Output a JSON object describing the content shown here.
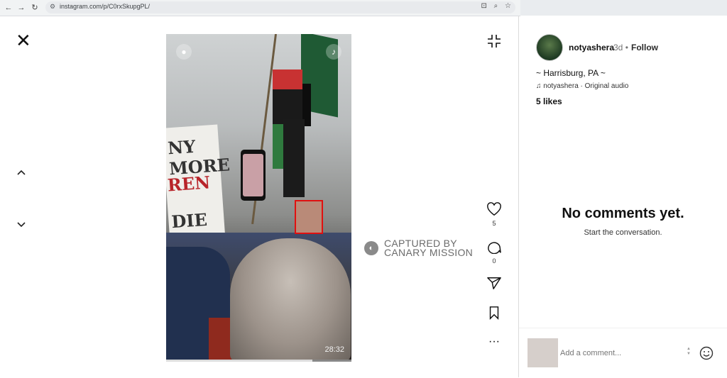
{
  "browser": {
    "url": "instagram.com/p/C0rxSkupgPL/",
    "nav": {
      "back": "←",
      "forward": "→",
      "reload": "↻"
    },
    "address_icons": [
      "install-icon",
      "zoom-icon",
      "star-icon"
    ]
  },
  "viewer": {
    "video_time": "28:32",
    "progress_fraction": 0.79,
    "watermark": {
      "line1": "CAPTURED BY",
      "line2": "CANARY MISSION"
    },
    "sign_text": [
      "NY MORE",
      "REN",
      "DIE"
    ],
    "likes_count": "5",
    "comments_count": "0"
  },
  "post": {
    "username": "notyashera",
    "age": "3d",
    "separator": "•",
    "follow_label": "Follow",
    "caption": "~ Harrisburg, PA ~",
    "audio": "notyashera · Original audio",
    "likes": "5 likes",
    "empty_title": "No comments yet.",
    "empty_subtitle": "Start the conversation.",
    "comment_placeholder": "Add a comment..."
  },
  "colors": {
    "highlight_box": "#e01010",
    "divider": "#dbdbdb"
  }
}
